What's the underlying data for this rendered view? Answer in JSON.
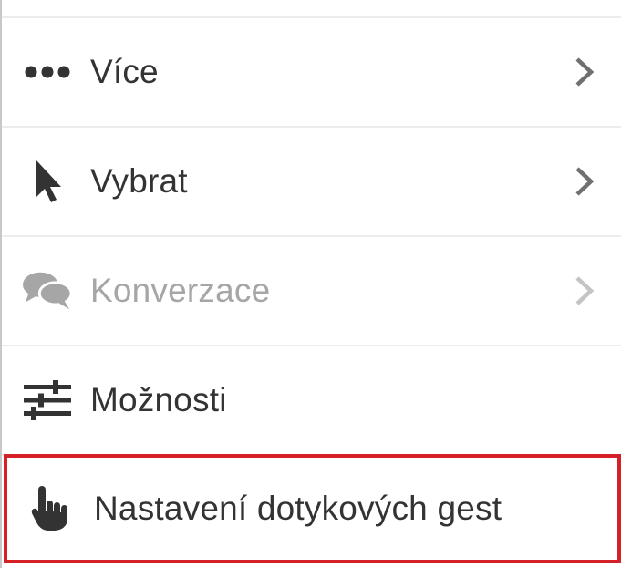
{
  "menu": {
    "items": [
      {
        "label": "Více",
        "icon": "more-dots-icon",
        "has_submenu": true,
        "enabled": true
      },
      {
        "label": "Vybrat",
        "icon": "cursor-arrow-icon",
        "has_submenu": true,
        "enabled": true
      },
      {
        "label": "Konverzace",
        "icon": "chat-bubbles-icon",
        "has_submenu": true,
        "enabled": false
      },
      {
        "label": "Možnosti",
        "icon": "sliders-icon",
        "has_submenu": false,
        "enabled": true
      },
      {
        "label": "Nastavení dotykových gest",
        "icon": "touch-hand-icon",
        "has_submenu": false,
        "enabled": true,
        "highlighted": true
      }
    ]
  },
  "colors": {
    "text": "#333333",
    "text_disabled": "#a6a6a6",
    "icon": "#333333",
    "icon_disabled": "#a6a6a6",
    "chevron": "#707070",
    "chevron_disabled": "#c4c4c4",
    "divider": "#ececec",
    "highlight_border": "#d62027"
  }
}
